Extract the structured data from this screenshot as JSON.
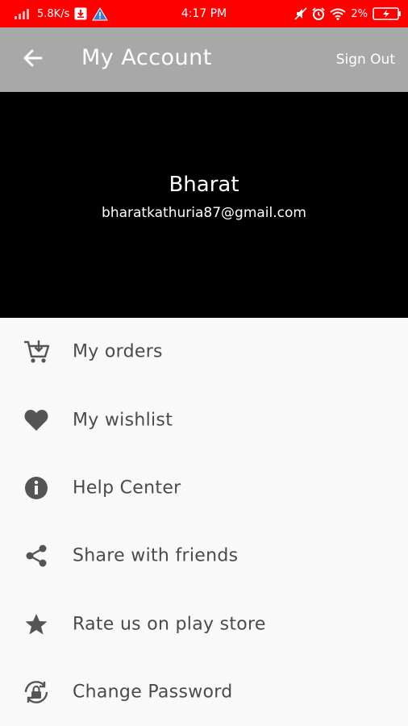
{
  "status_bar": {
    "network_speed": "5.8K/s",
    "time": "4:17 PM",
    "battery": "2%",
    "colors": {
      "background": "#ff0000"
    }
  },
  "app_bar": {
    "title": "My Account",
    "sign_out_label": "Sign Out",
    "back_icon": "arrow-left-icon",
    "colors": {
      "background": "#a8a8a8"
    }
  },
  "profile": {
    "name": "Bharat",
    "email": "bharatkathuria87@gmail.com"
  },
  "menu": {
    "items": [
      {
        "label": "My orders",
        "icon": "cart-icon"
      },
      {
        "label": "My wishlist",
        "icon": "heart-icon"
      },
      {
        "label": "Help Center",
        "icon": "info-icon"
      },
      {
        "label": "Share with friends",
        "icon": "share-icon"
      },
      {
        "label": "Rate us on play store",
        "icon": "star-icon"
      },
      {
        "label": "Change Password",
        "icon": "lock-refresh-icon"
      }
    ]
  }
}
